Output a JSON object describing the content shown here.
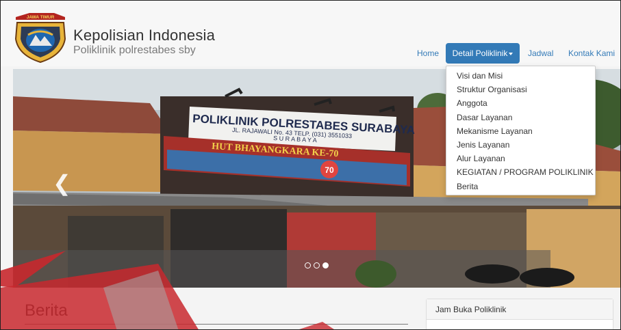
{
  "header": {
    "badge_text": "JAWA TIMUR",
    "title": "Kepolisian Indonesia",
    "subtitle": "Poliklinik polrestabes sby"
  },
  "nav": {
    "home": "Home",
    "detail": "Detail Poliklinik",
    "jadwal": "Jadwal",
    "kontak": "Kontak Kami"
  },
  "dropdown": {
    "items": [
      "Visi dan Misi",
      "Struktur Organisasi",
      "Anggota",
      "Dasar Layanan",
      "Mekanisme Layanan",
      "Jenis Layanan",
      "Alur Layanan",
      "KEGIATAN / PROGRAM POLIKLINIK",
      "Berita"
    ]
  },
  "carousel": {
    "sign_line1": "POLIKLINIK POLRESTABES SURABAYA",
    "sign_line2": "JL. RAJAWALI No. 43 TELP. (031) 3551033",
    "sign_line3": "S U R A B A Y A",
    "banner_text": "HUT BHAYANGKARA KE-70",
    "banner_badge": "70",
    "slide_count": 3,
    "active_slide": 3
  },
  "main": {
    "berita_heading": "Berita"
  },
  "sidebar": {
    "panel_title": "Jam Buka Poliklinik"
  },
  "colors": {
    "primary": "#337ab7",
    "watermark_red": "#c8282e"
  },
  "icons": {
    "carousel_prev": "chevron-left-icon",
    "dropdown_caret": "caret-down-icon"
  }
}
